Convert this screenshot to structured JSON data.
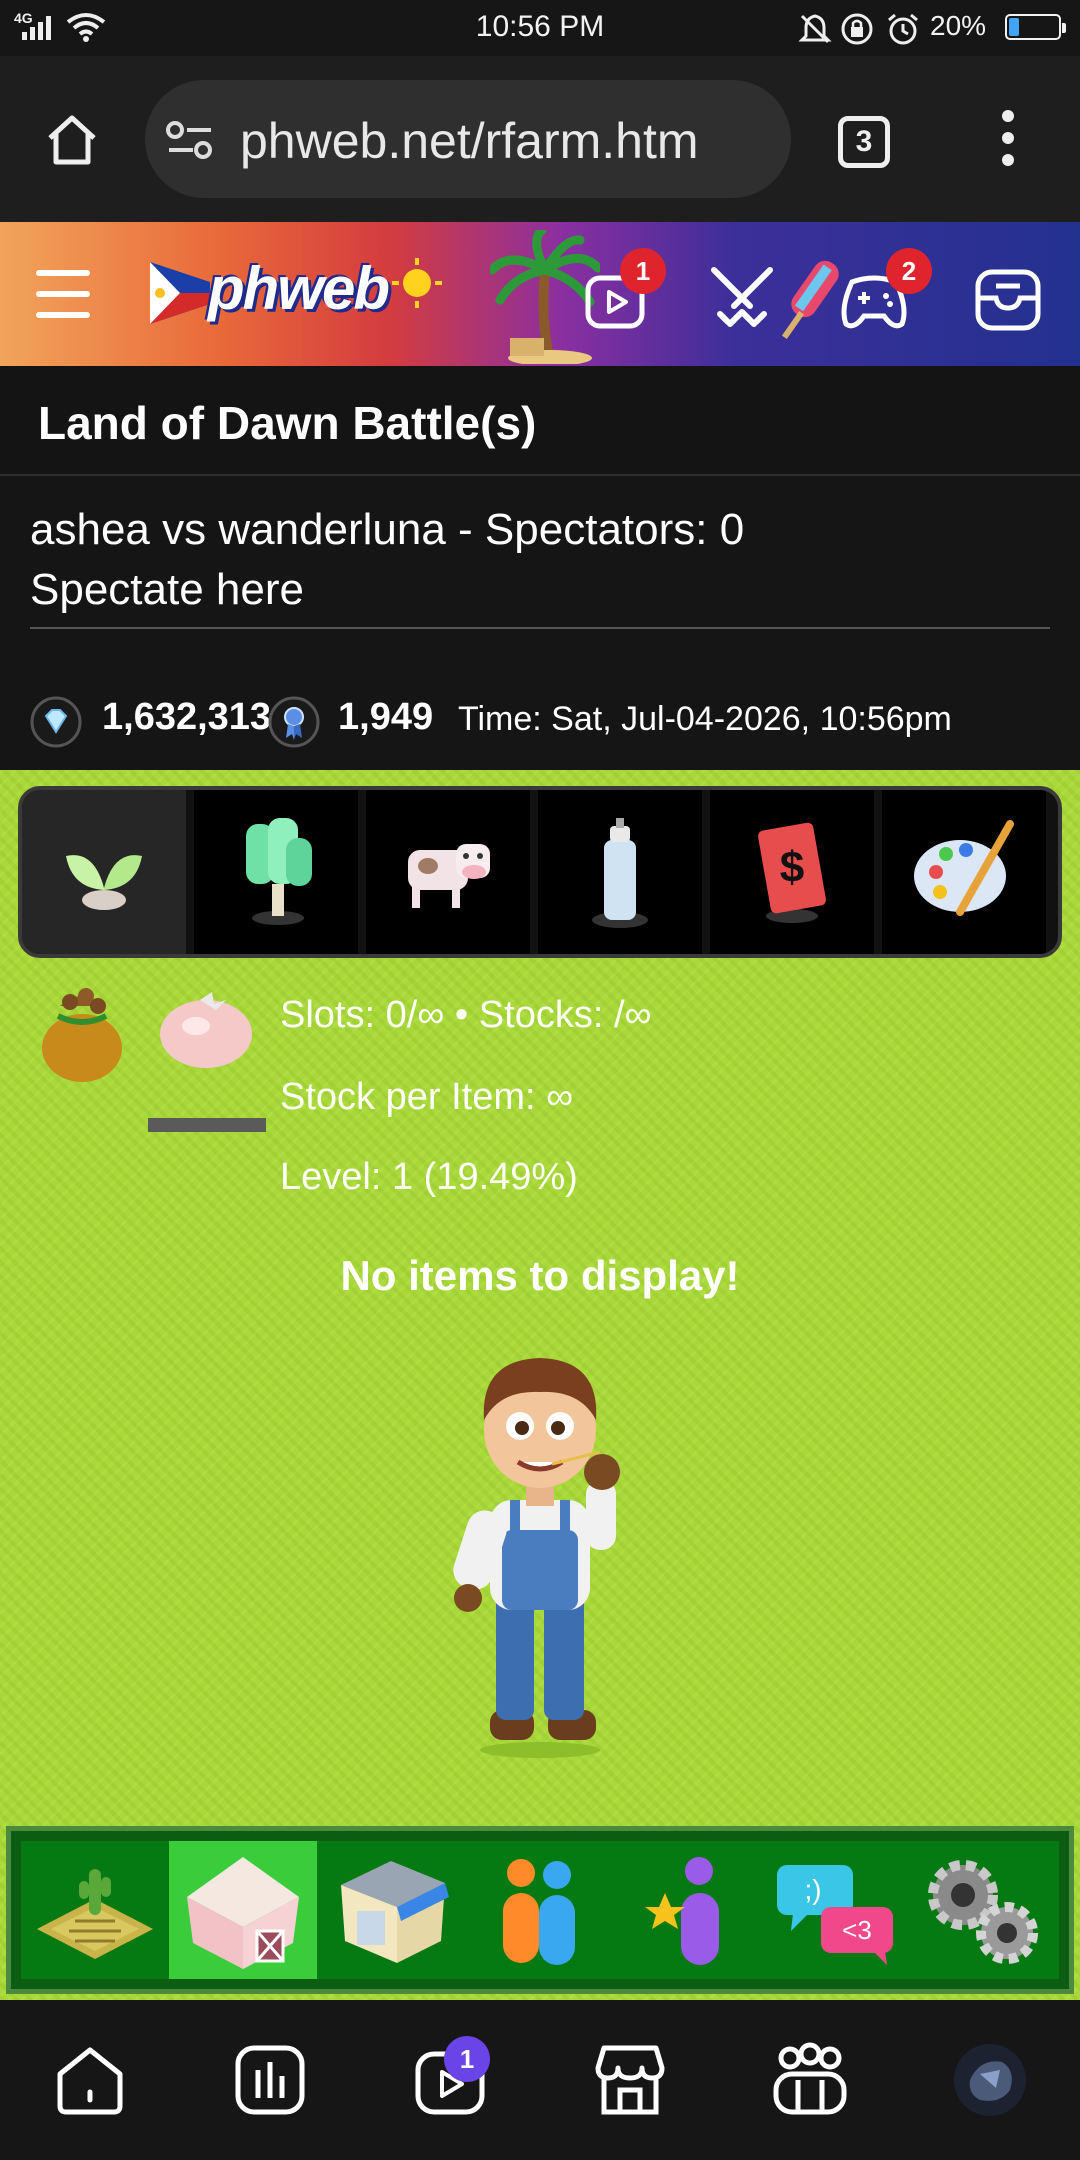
{
  "status_bar": {
    "network": "4G",
    "time": "10:56 PM",
    "battery_percent": "20%",
    "battery_level": 0.2,
    "icons": [
      "signal-icon",
      "wifi-icon",
      "mute-icon",
      "lock-rotation-icon",
      "alarm-icon",
      "battery-icon"
    ]
  },
  "browser": {
    "url": "phweb.net/rfarm.htm",
    "tab_count": "3",
    "icons": [
      "home-icon",
      "site-settings-icon",
      "tabs-icon",
      "menu-icon"
    ]
  },
  "site_header": {
    "logo_text": "phweb",
    "badges": {
      "videos": "1",
      "games": "2"
    },
    "icons": [
      "hamburger-menu-icon",
      "logo",
      "video-icon",
      "battle-swords-icon",
      "gamepad-icon",
      "inbox-icon"
    ]
  },
  "page": {
    "title": "Land of Dawn Battle(s)",
    "battle_line": "ashea vs wanderluna - Spectators: 0",
    "spectate_link": "Spectate here",
    "diamonds": "1,632,313",
    "ribbons": "1,949",
    "time_label": "Time: Sat, Jul-04-2026, 10:56pm"
  },
  "farm": {
    "category_tabs": [
      "seedling-icon",
      "tree-icon",
      "cow-icon",
      "spray-can-icon",
      "money-card-icon",
      "paint-palette-icon"
    ],
    "active_category": 0,
    "slots_line": "Slots: 0/∞ • Stocks: /∞",
    "stock_per_item": "Stock per Item: ∞",
    "level": "Level: 1 (19.49%)",
    "empty_message": "No items to display!",
    "game_nav": [
      "farm-plot-icon",
      "barn-icon",
      "shop-icon",
      "friends-icon",
      "star-user-icon",
      "chat-icon",
      "settings-gears-icon"
    ],
    "active_game_nav": 1
  },
  "bottom_nav": {
    "items": [
      "home-icon",
      "stats-icon",
      "video-icon",
      "shop-icon",
      "groups-icon",
      "avatar"
    ],
    "video_badge": "1"
  }
}
